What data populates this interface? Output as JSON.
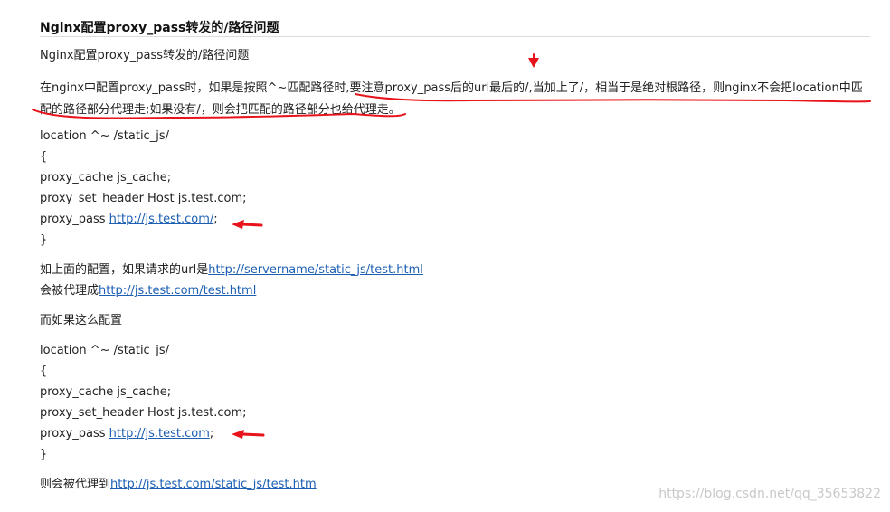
{
  "article": {
    "title": "Nginx配置proxy_pass转发的/路径问题",
    "subtitle": "Nginx配置proxy_pass转发的/路径问题",
    "paragraph": "在nginx中配置proxy_pass时，如果是按照^~匹配路径时,要注意proxy_pass后的url最后的/,当加上了/，相当于是绝对根路径，则nginx不会把location中匹配的路径部分代理走;如果没有/，则会把匹配的路径部分也给代理走。",
    "block1": {
      "location": "location ^~ /static_js/",
      "open": "{",
      "cache": "proxy_cache js_cache;",
      "header": "proxy_set_header Host js.test.com;",
      "pass_prefix": "proxy_pass ",
      "pass_link": "http://js.test.com/",
      "pass_suffix": ";",
      "close": "}"
    },
    "example1": {
      "line1_prefix": "如上面的配置，如果请求的url是",
      "line1_link": "http://servername/static_js/test.html",
      "line2_prefix": "会被代理成",
      "line2_link": "http://js.test.com/test.html"
    },
    "transition": "而如果这么配置",
    "block2": {
      "location": "location ^~ /static_js/",
      "open": "{",
      "cache": "proxy_cache js_cache;",
      "header": "proxy_set_header Host js.test.com;",
      "pass_prefix": "proxy_pass ",
      "pass_link": "http://js.test.com",
      "pass_suffix": ";",
      "close": "}"
    },
    "result": {
      "prefix": "则会被代理到",
      "link": "http://js.test.com/static_js/test.htm"
    }
  },
  "watermark": "https://blog.csdn.net/qq_35653822",
  "annotation_color": "#e8131b"
}
